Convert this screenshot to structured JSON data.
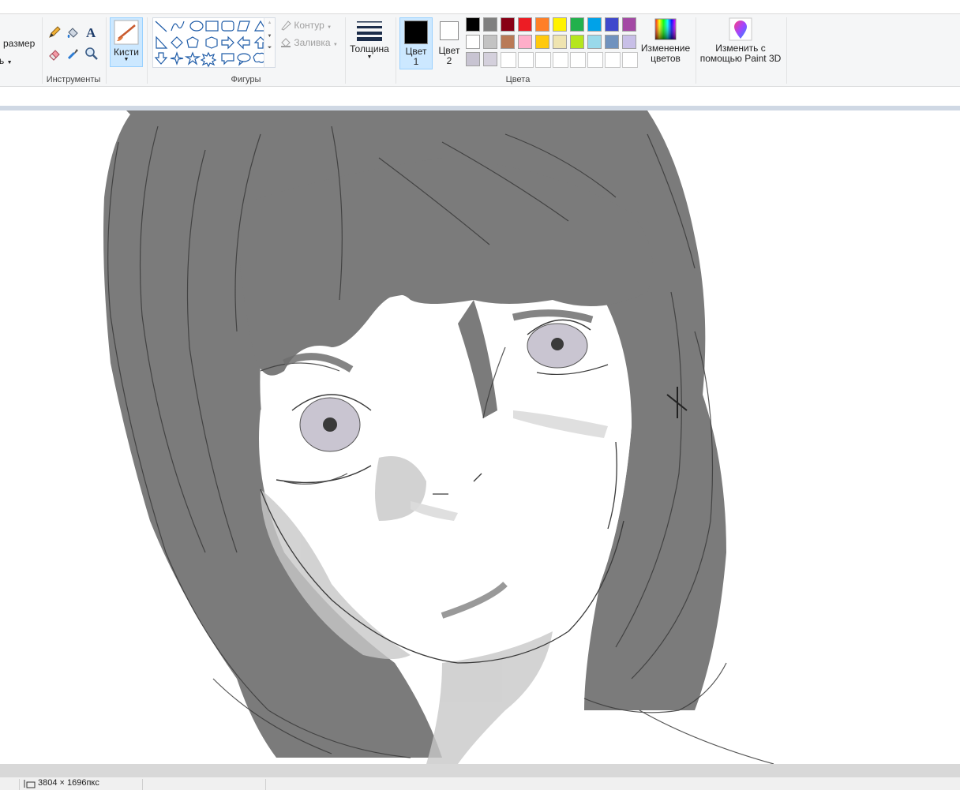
{
  "ribbon": {
    "image_group": {
      "resize_label": "размер",
      "partial_label": "ь"
    },
    "tools_group": {
      "label": "Инструменты"
    },
    "brushes": {
      "label": "Кисти"
    },
    "shapes_group": {
      "label": "Фигуры",
      "outline_label": "Контур",
      "fill_label": "Заливка"
    },
    "size": {
      "label": "Толщина"
    },
    "color1": {
      "label_line1": "Цвет",
      "label_line2": "1",
      "value": "#000000"
    },
    "color2": {
      "label_line1": "Цвет",
      "label_line2": "2",
      "value": "#ffffff"
    },
    "colors_group": {
      "label": "Цвета",
      "palette_row1": [
        "#000000",
        "#7f7f7f",
        "#880015",
        "#ed1c24",
        "#ff7f27",
        "#fff200",
        "#22b14c",
        "#00a2e8",
        "#3f48cc",
        "#a349a4"
      ],
      "palette_row2": [
        "#ffffff",
        "#c3c3c3",
        "#b97a57",
        "#ffaec9",
        "#ffc90e",
        "#efe4b0",
        "#b5e61d",
        "#99d9ea",
        "#7092be",
        "#c8bfe7"
      ],
      "palette_row3": [
        "#c8c4d2",
        "#d4d0dc"
      ],
      "edit_colors_line1": "Изменение",
      "edit_colors_line2": "цветов"
    },
    "paint3d": {
      "line1": "Изменить с",
      "line2": "помощью Paint 3D"
    }
  },
  "statusbar": {
    "dimensions": "3804 × 1696пкс"
  },
  "colors": {
    "accent": "#cce8ff",
    "workspace": "#cfd8e4",
    "hair": "#7a7a7a",
    "outline": "#3a3a3a",
    "iris": "#c9c5d1"
  }
}
